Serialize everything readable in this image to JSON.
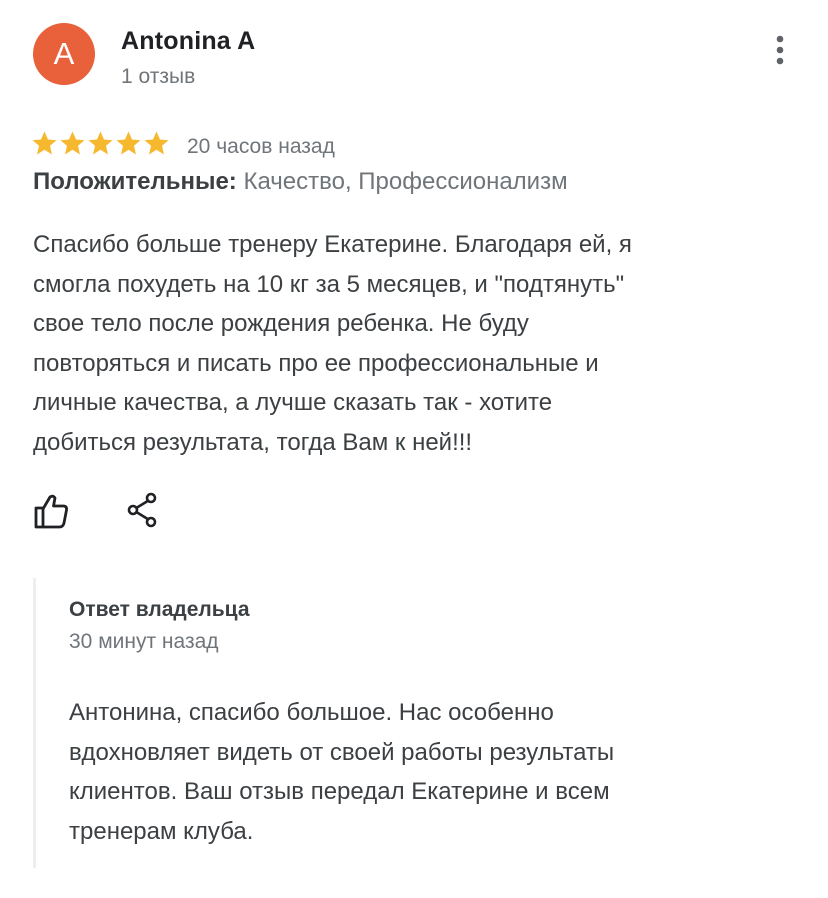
{
  "review": {
    "author": {
      "initial": "A",
      "name": "Antonina A",
      "review_count": "1 отзыв",
      "avatar_color": "#e8613a"
    },
    "rating": 5,
    "rating_max": 5,
    "star_color": "#f5b82e",
    "time_ago": "20 часов назад",
    "positives_label": "Положительные:",
    "positives_values": "Качество, Профессионализм",
    "text": "Спасибо больше тренеру Екатерине. Благодаря ей, я\nсмогла похудеть на 10 кг за 5 месяцев, и \"подтянуть\"\nсвое тело после рождения ребенка. Не буду\nповторяться и писать про ее профессиональные и\nличные качества, а лучше сказать так - хотите\nдобиться результата, тогда Вам к ней!!!",
    "actions": {
      "like_icon": "thumbs-up-icon",
      "share_icon": "share-icon",
      "more_icon": "more-vertical-icon"
    }
  },
  "owner_reply": {
    "title": "Ответ владельца",
    "time_ago": "30 минут назад",
    "text": "Антонина, спасибо большое. Нас особенно\nвдохновляет видеть от своей работы результаты\nклиентов. Ваш отзыв передал Екатерине и всем\nтренерам клуба."
  }
}
